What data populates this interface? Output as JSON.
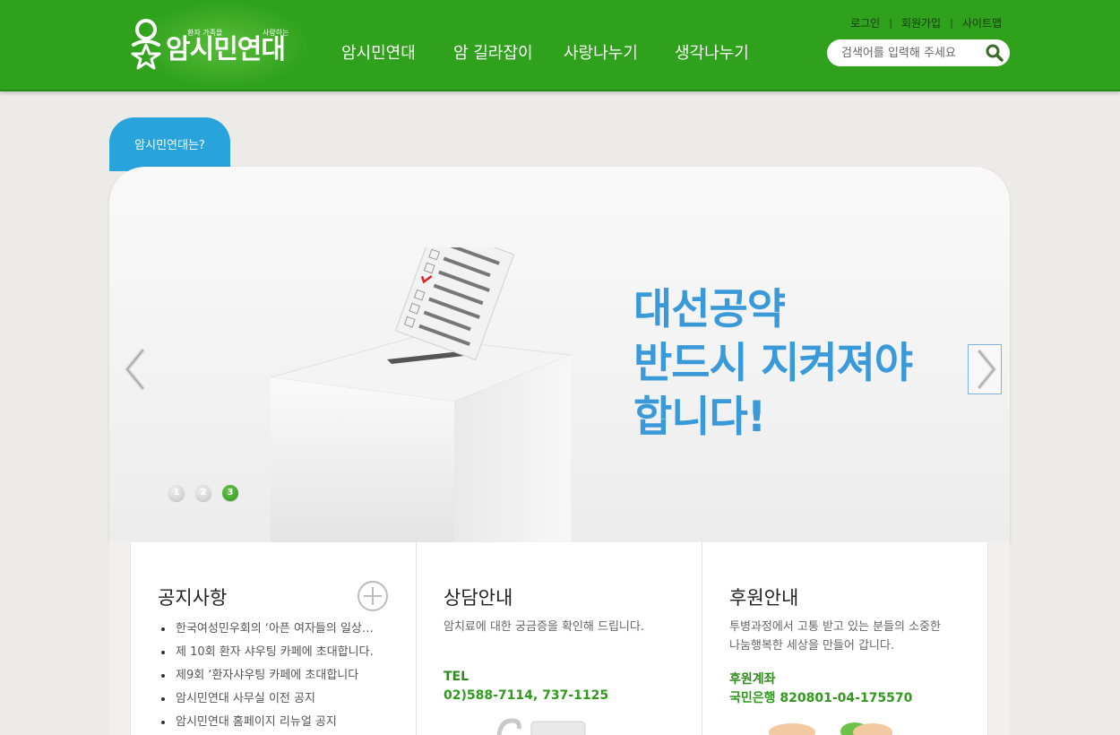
{
  "header": {
    "logo": {
      "main": "암시민연대",
      "small_a": "환자 가족을",
      "small_b": "사랑하는"
    },
    "nav": [
      {
        "label": "암시민연대"
      },
      {
        "label": "암 길라잡이"
      },
      {
        "label": "사랑나누기"
      },
      {
        "label": "생각나누기"
      }
    ],
    "util_links": {
      "login": "로그인",
      "signup": "회원가입",
      "sitemap": "사이트맵"
    },
    "search": {
      "placeholder": "검색어를 입력해 주세요",
      "icon": "search-icon"
    }
  },
  "about_tab": "암시민연대는?",
  "visual": {
    "headline": [
      "대선공약",
      "반드시 지켜져야",
      "합니다!"
    ],
    "pager": [
      "1",
      "2",
      "3"
    ],
    "active_page": "3"
  },
  "panels": {
    "notice": {
      "title": "공지사항",
      "items": [
        "한국여성민우회의 ‘아픈 여자들의 일상…",
        "제 10회 환자 샤우팅 카페에 초대합니다.",
        "제9회 ‘환자샤우팅 카페에 초대합니다",
        "암시민연대 사무실 이전 공지",
        "암시민연대 홈페이지 리뉴얼 공지"
      ]
    },
    "consult": {
      "title": "상담안내",
      "desc": "암치료에 대한 궁금증을 확인해 드립니다.",
      "tel_label": "TEL",
      "tel_value": "02)588-7114, 737-1125"
    },
    "support": {
      "title": "후원안내",
      "desc_1": "투병과정에서 고통 받고 있는 분들의 소중한",
      "desc_2": "나눔행복한 세상을 만들어 갑니다.",
      "account_label": "후원계좌",
      "account_value": "국민은행 820801-04-175570"
    }
  },
  "colors": {
    "header_green": "#2fa11c",
    "accent_blue": "#3a9ad9",
    "tab_blue": "#29a3dc",
    "text_green": "#2f9a1c"
  }
}
